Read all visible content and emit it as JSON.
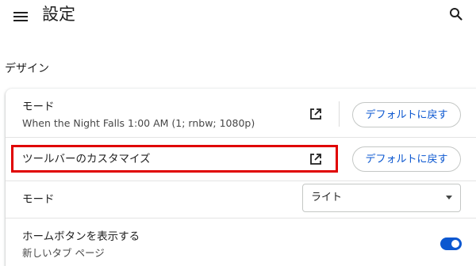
{
  "header": {
    "title": "設定"
  },
  "section": {
    "title": "デザイン"
  },
  "rows": {
    "mode_theme": {
      "label": "モード",
      "sublabel": "When the Night Falls 1:00 AM (1; rnbw; 1080p)",
      "reset_label": "デフォルトに戻す"
    },
    "toolbar_customize": {
      "label": "ツールバーのカスタマイズ",
      "reset_label": "デフォルトに戻す"
    },
    "mode_select": {
      "label": "モード",
      "selected_value": "ライト"
    },
    "home_button": {
      "label": "ホームボタンを表示する",
      "sublabel": "新しいタブ ページ",
      "enabled": true
    }
  },
  "colors": {
    "accent": "#0b57d0",
    "highlight": "#e00000"
  },
  "icons": {
    "menu": "hamburger-menu-icon",
    "search": "search-icon",
    "external": "open-in-new-icon"
  }
}
